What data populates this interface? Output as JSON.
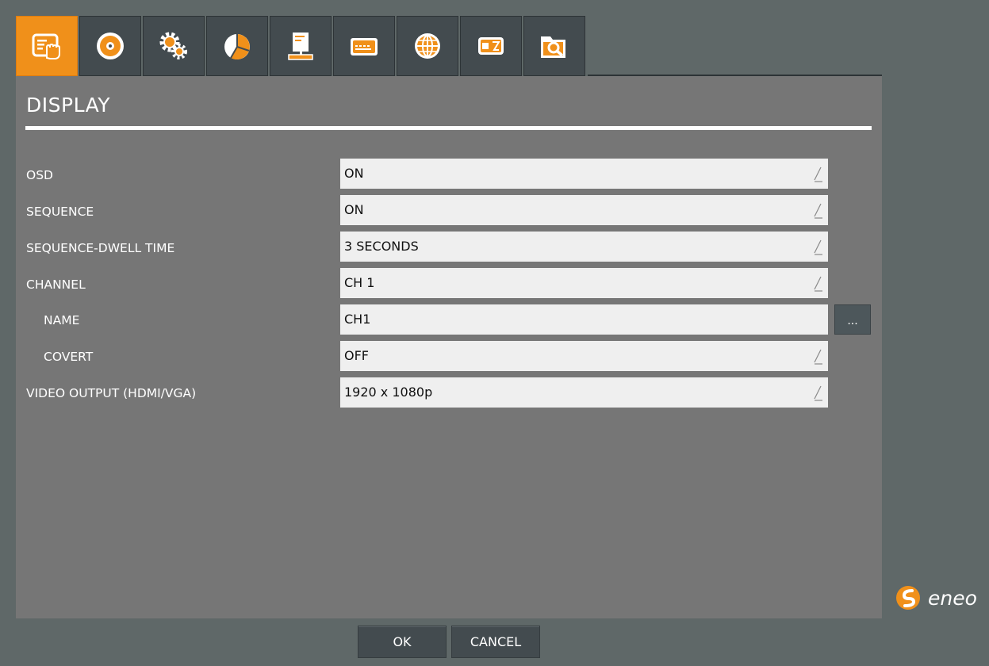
{
  "tabs": [
    {
      "icon": "display-hand-icon",
      "active": true
    },
    {
      "icon": "disc-record-icon",
      "active": false
    },
    {
      "icon": "gear-settings-icon",
      "active": false
    },
    {
      "icon": "pie-chart-icon",
      "active": false
    },
    {
      "icon": "computer-system-icon",
      "active": false
    },
    {
      "icon": "keyboard-icon",
      "active": false
    },
    {
      "icon": "globe-network-icon",
      "active": false
    },
    {
      "icon": "storage-device-icon",
      "active": false
    },
    {
      "icon": "search-folder-icon",
      "active": false
    }
  ],
  "page": {
    "title": "DISPLAY"
  },
  "settings": {
    "osd": {
      "label": "OSD",
      "value": "ON"
    },
    "sequence": {
      "label": "SEQUENCE",
      "value": "ON"
    },
    "dwell": {
      "label": "SEQUENCE-DWELL TIME",
      "value": "3 SECONDS"
    },
    "channel": {
      "label": "CHANNEL",
      "value": "CH 1"
    },
    "name": {
      "label": "NAME",
      "value": "CH1",
      "button": "..."
    },
    "covert": {
      "label": "COVERT",
      "value": "OFF"
    },
    "video_output": {
      "label": "VIDEO OUTPUT (HDMI/VGA)",
      "value": "1920 x 1080p"
    }
  },
  "buttons": {
    "ok": "OK",
    "cancel": "CANCEL"
  },
  "logo": {
    "text": "eneo"
  },
  "colors": {
    "accent": "#f0901a",
    "panel": "#767676",
    "background": "#5f6868",
    "tab": "#434b4f"
  }
}
